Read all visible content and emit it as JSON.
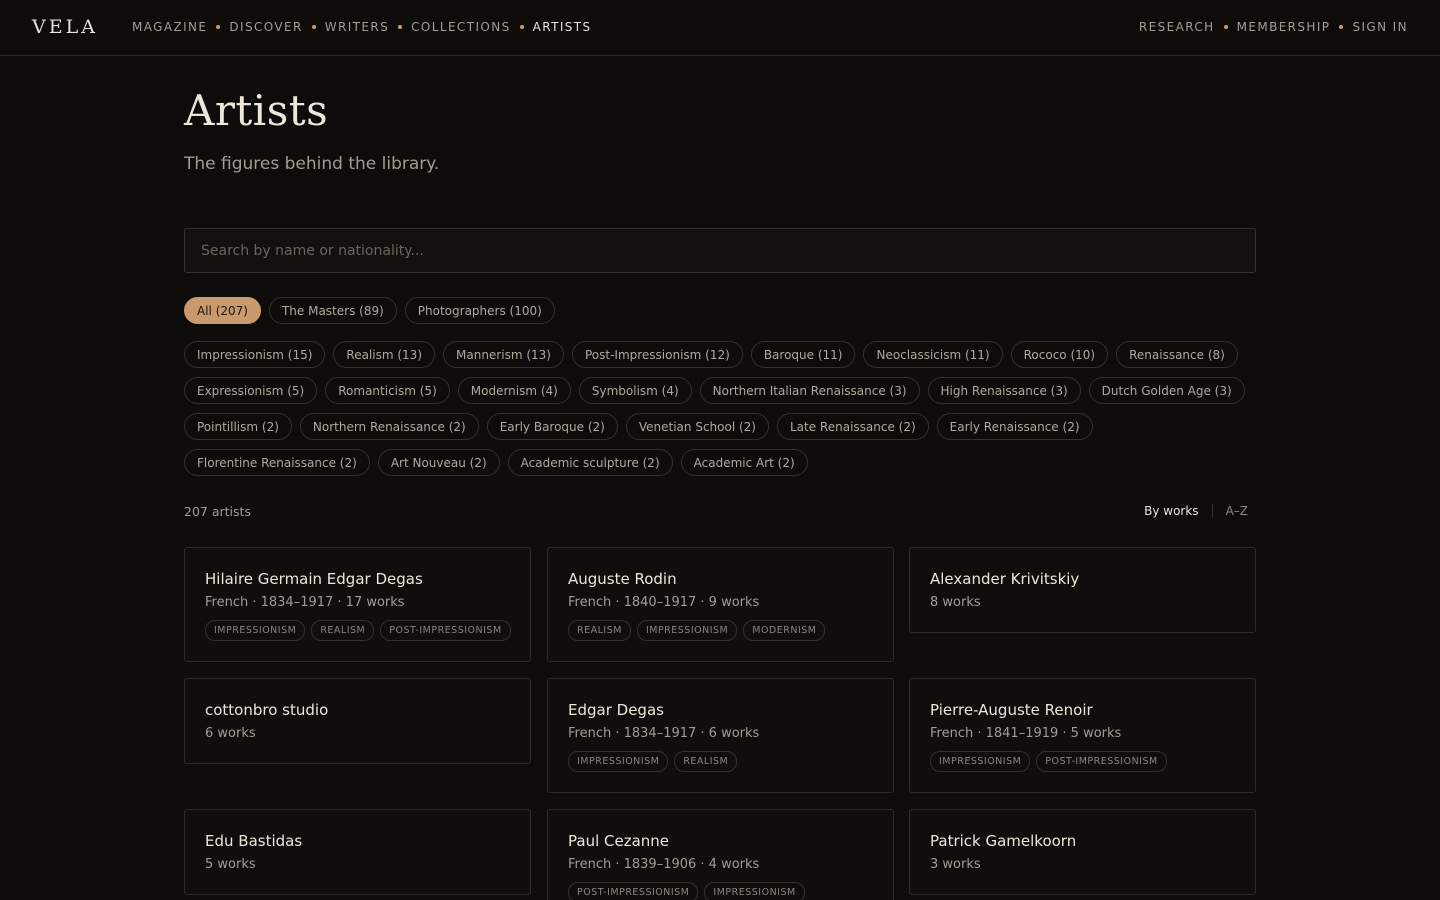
{
  "brand": "VELA",
  "nav_left": [
    "MAGAZINE",
    "DISCOVER",
    "WRITERS",
    "COLLECTIONS",
    "ARTISTS"
  ],
  "nav_active": "ARTISTS",
  "nav_right": [
    "RESEARCH",
    "MEMBERSHIP",
    "SIGN IN"
  ],
  "page": {
    "title": "Artists",
    "subtitle": "The figures behind the library."
  },
  "search": {
    "placeholder": "Search by name or nationality..."
  },
  "groups": [
    "All (207)",
    "The Masters (89)",
    "Photographers (100)"
  ],
  "movements": [
    [
      "Impressionism (15)",
      "Realism (13)",
      "Mannerism (13)",
      "Post-Impressionism (12)",
      "Baroque (11)",
      "Neoclassicism (11)",
      "Rococo (10)",
      "Renaissance (8)"
    ],
    [
      "Expressionism (5)",
      "Romanticism (5)",
      "Modernism (4)",
      "Symbolism (4)",
      "Northern Italian Renaissance (3)",
      "High Renaissance (3)",
      "Dutch Golden Age (3)"
    ],
    [
      "Pointillism (2)",
      "Northern Renaissance (2)",
      "Early Baroque (2)",
      "Venetian School (2)",
      "Late Renaissance (2)",
      "Early Renaissance (2)"
    ],
    [
      "Florentine Renaissance (2)",
      "Art Nouveau (2)",
      "Academic sculpture (2)",
      "Academic Art (2)"
    ]
  ],
  "results": {
    "count": "207 artists"
  },
  "sort": {
    "by_works": "By works",
    "az": "A–Z",
    "active": "By works"
  },
  "artists": [
    {
      "name": "Hilaire Germain Edgar Degas",
      "meta": "French · 1834–1917 · 17 works",
      "tags": [
        "IMPRESSIONISM",
        "REALISM",
        "POST-IMPRESSIONISM"
      ]
    },
    {
      "name": "Auguste Rodin",
      "meta": "French · 1840–1917 · 9 works",
      "tags": [
        "REALISM",
        "IMPRESSIONISM",
        "MODERNISM"
      ]
    },
    {
      "name": "Alexander Krivitskiy",
      "meta": "8 works",
      "tags": []
    },
    {
      "name": "cottonbro studio",
      "meta": "6 works",
      "tags": []
    },
    {
      "name": "Edgar Degas",
      "meta": "French · 1834–1917 · 6 works",
      "tags": [
        "IMPRESSIONISM",
        "REALISM"
      ]
    },
    {
      "name": "Pierre-Auguste Renoir",
      "meta": "French · 1841–1919 · 5 works",
      "tags": [
        "IMPRESSIONISM",
        "POST-IMPRESSIONISM"
      ]
    },
    {
      "name": "Edu Bastidas",
      "meta": "5 works",
      "tags": []
    },
    {
      "name": "Paul Cezanne",
      "meta": "French · 1839–1906 · 4 works",
      "tags": [
        "POST-IMPRESSIONISM",
        "IMPRESSIONISM"
      ]
    },
    {
      "name": "Patrick Gamelkoorn",
      "meta": "3 works",
      "tags": []
    }
  ],
  "colors": {
    "background": "#0d0c0b",
    "accent": "#c99a6c",
    "text": "#e8e2d8",
    "muted": "#a39c91"
  }
}
